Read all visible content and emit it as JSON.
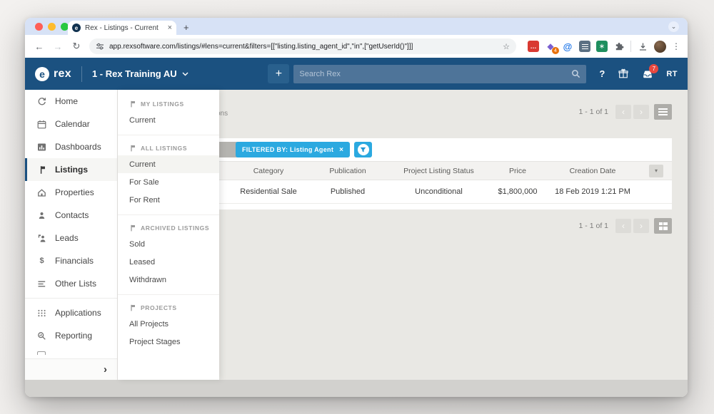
{
  "colors": {
    "header_bg": "#1b5180",
    "filter_blue": "#2ba9e0",
    "badge_red": "#e8483f",
    "tabstrip": "#d7e2f6"
  },
  "browser": {
    "tab_title": "Rex - Listings - Current",
    "favicon_letter": "e",
    "close_glyph": "×",
    "new_tab_glyph": "+",
    "strip_chevron": "⌄",
    "back_glyph": "←",
    "forward_glyph": "→",
    "reload_glyph": "↻",
    "url": "app.rexsoftware.com/listings/#lens=current&filters=[[\"listing.listing_agent_id\",\"in\",[\"getUserId()\"]]]",
    "star_glyph": "☆",
    "ext_red_glyph": "…",
    "ext_purple_glyph": "◆",
    "ext_purple_badge": "4",
    "ext_at_glyph": "@",
    "ext_green_glyph": "∗",
    "menu_dots": "⋮"
  },
  "header": {
    "brand_letter": "e",
    "brand": "rex",
    "account": "1 - Rex Training AU",
    "add_label": "+",
    "search_placeholder": "Search Rex",
    "help_glyph": "?",
    "notification_count": "7",
    "avatar_initials": "RT"
  },
  "sidebar": {
    "items": [
      "Home",
      "Calendar",
      "Dashboards",
      "Listings",
      "Properties",
      "Contacts",
      "Leads",
      "Financials",
      "Other Lists",
      "Applications",
      "Reporting"
    ],
    "dollar_glyph": "$",
    "expand_glyph": "›"
  },
  "flyout": {
    "sections": [
      {
        "title": "MY LISTINGS",
        "items": [
          "Current"
        ]
      },
      {
        "title": "ALL LISTINGS",
        "items": [
          "Current",
          "For Sale",
          "For Rent"
        ]
      },
      {
        "title": "ARCHIVED LISTINGS",
        "items": [
          "Sold",
          "Leased",
          "Withdrawn"
        ]
      },
      {
        "title": "PROJECTS",
        "items": [
          "All Projects",
          "Project Stages"
        ]
      }
    ]
  },
  "content": {
    "fragment": "ons",
    "pagination_top": "1 - 1 of 1",
    "pagination_bottom": "1 - 1 of 1",
    "prev_glyph": "‹",
    "next_glyph": "›",
    "filter_label": "FILTERED BY: Listing Agent",
    "filter_close": "×",
    "header_caret": "▾",
    "table": {
      "columns": [
        "Category",
        "Publication",
        "Project Listing Status",
        "Price",
        "Creation Date"
      ],
      "rows": [
        [
          "Residential Sale",
          "Published",
          "Unconditional",
          "$1,800,000",
          "18 Feb 2019 1:21 PM"
        ]
      ]
    }
  }
}
